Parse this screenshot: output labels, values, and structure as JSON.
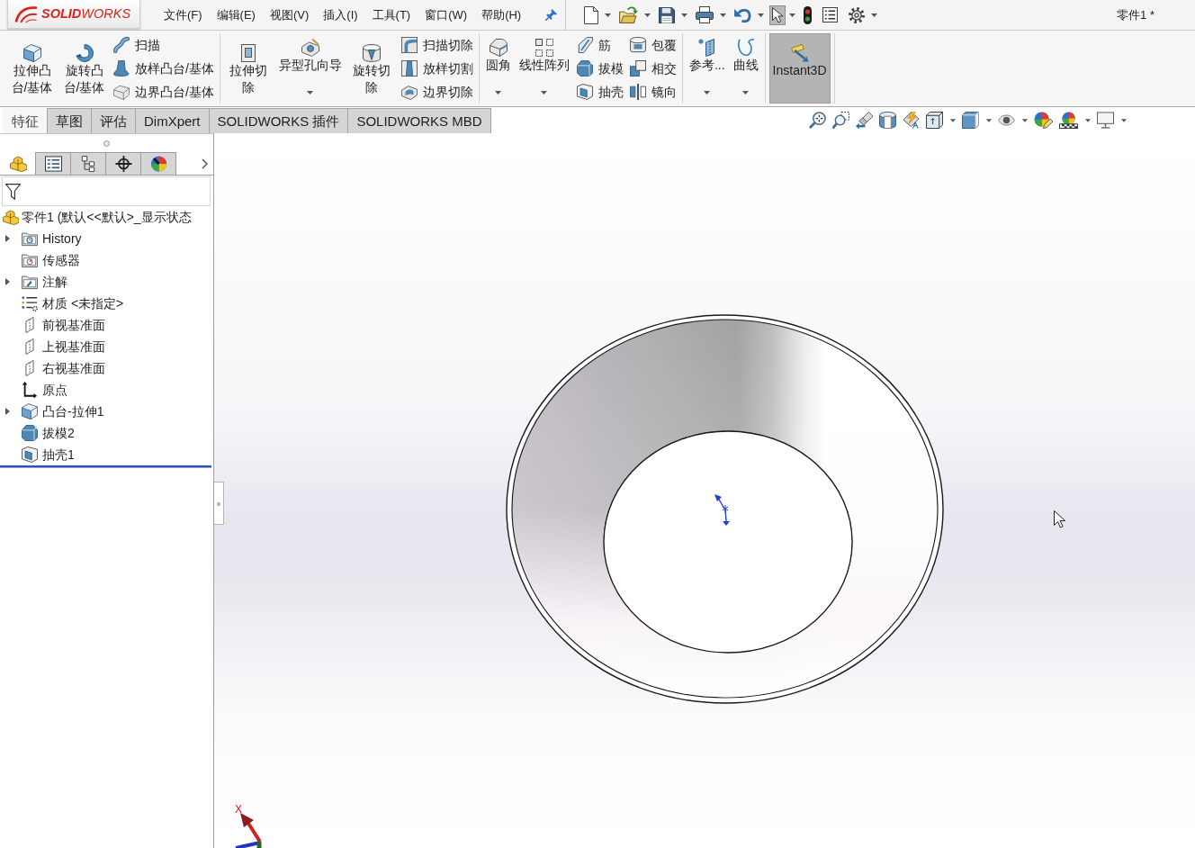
{
  "app": {
    "logo_text": "**SOLID**WORKS"
  },
  "menu": [
    "文件(F)",
    "编辑(E)",
    "视图(V)",
    "插入(I)",
    "工具(T)",
    "窗口(W)",
    "帮助(H)"
  ],
  "quick_access": [
    {
      "dropdown": true,
      "pressed": false
    },
    {
      "dropdown": true,
      "pressed": false
    },
    {
      "dropdown": true,
      "pressed": false
    },
    {
      "dropdown": true,
      "pressed": false
    },
    {
      "dropdown": true,
      "pressed": false
    },
    {
      "dropdown": true,
      "pressed": true
    },
    {
      "dropdown": false,
      "pressed": false
    },
    {
      "dropdown": false,
      "pressed": false
    },
    {
      "dropdown": true,
      "pressed": false
    }
  ],
  "document_title": "零件1 *",
  "ribbon_groups": [
    {
      "items": [
        {
          "kind": "large",
          "label": "拉伸凸台/基体",
          "dropdown": false,
          "pressed": false
        },
        {
          "kind": "large",
          "label": "旋转凸台/基体",
          "dropdown": false,
          "pressed": false
        },
        {
          "kind": "stack",
          "items": [
            {
              "label": "扫描"
            },
            {
              "label": "放样凸台/基体"
            },
            {
              "label": "边界凸台/基体"
            }
          ]
        }
      ]
    },
    {
      "items": [
        {
          "kind": "large",
          "label": "拉伸切除",
          "dropdown": false,
          "pressed": false
        },
        {
          "kind": "large",
          "label": "异型孔向导",
          "dropdown": true,
          "pressed": false
        },
        {
          "kind": "large",
          "label": "旋转切除",
          "dropdown": false,
          "pressed": false
        },
        {
          "kind": "stack",
          "items": [
            {
              "label": "扫描切除"
            },
            {
              "label": "放样切割"
            },
            {
              "label": "边界切除"
            }
          ]
        }
      ]
    },
    {
      "items": [
        {
          "kind": "large",
          "label": "圆角",
          "dropdown": true,
          "pressed": false
        },
        {
          "kind": "large",
          "label": "线性阵列",
          "dropdown": true,
          "pressed": false
        },
        {
          "kind": "stack",
          "items": [
            {
              "label": "筋"
            },
            {
              "label": "拔模"
            },
            {
              "label": "抽壳"
            }
          ]
        },
        {
          "kind": "stack",
          "items": [
            {
              "label": "包覆"
            },
            {
              "label": "相交"
            },
            {
              "label": "镜向"
            }
          ]
        }
      ]
    },
    {
      "items": [
        {
          "kind": "large",
          "label": "参考...",
          "dropdown": true,
          "pressed": false
        },
        {
          "kind": "large",
          "label": "曲线",
          "dropdown": true,
          "pressed": false
        }
      ]
    },
    {
      "items": [
        {
          "kind": "large",
          "label": "Instant3D",
          "dropdown": false,
          "pressed": true
        }
      ]
    }
  ],
  "command_tabs": [
    {
      "label": "特征",
      "selected": true
    },
    {
      "label": "草图",
      "selected": false
    },
    {
      "label": "评估",
      "selected": false
    },
    {
      "label": "DimXpert",
      "selected": false
    },
    {
      "label": "SOLIDWORKS 插件",
      "selected": false
    },
    {
      "label": "SOLIDWORKS MBD",
      "selected": false
    }
  ],
  "view_toolbar": [
    {
      "dropdown": false
    },
    {
      "dropdown": false
    },
    {
      "dropdown": false
    },
    {
      "dropdown": false
    },
    {
      "dropdown": false
    },
    {
      "dropdown": true
    },
    {
      "dropdown": true
    },
    {
      "dropdown": true
    },
    {
      "dropdown": false
    },
    {
      "dropdown": true
    },
    {
      "dropdown": true
    }
  ],
  "feature_manager": {
    "tabs": [
      {
        "selected": true
      },
      {
        "selected": false
      },
      {
        "selected": false
      },
      {
        "selected": false
      },
      {
        "selected": false
      }
    ],
    "tree": {
      "label": "零件1 (默认<<默认>_显示状态",
      "children": [
        {
          "label": "History",
          "expandable": true
        },
        {
          "label": "传感器",
          "expandable": false
        },
        {
          "label": "注解",
          "expandable": true
        },
        {
          "label": "材质 <未指定>",
          "expandable": false
        },
        {
          "label": "前视基准面",
          "expandable": false
        },
        {
          "label": "上视基准面",
          "expandable": false
        },
        {
          "label": "右视基准面",
          "expandable": false
        },
        {
          "label": "原点",
          "expandable": false
        },
        {
          "label": "凸台-拉伸1",
          "expandable": true
        },
        {
          "label": "拔模2",
          "expandable": false
        },
        {
          "label": "抽壳1",
          "expandable": false
        }
      ]
    }
  },
  "graphics": {
    "triad_label": "X"
  }
}
